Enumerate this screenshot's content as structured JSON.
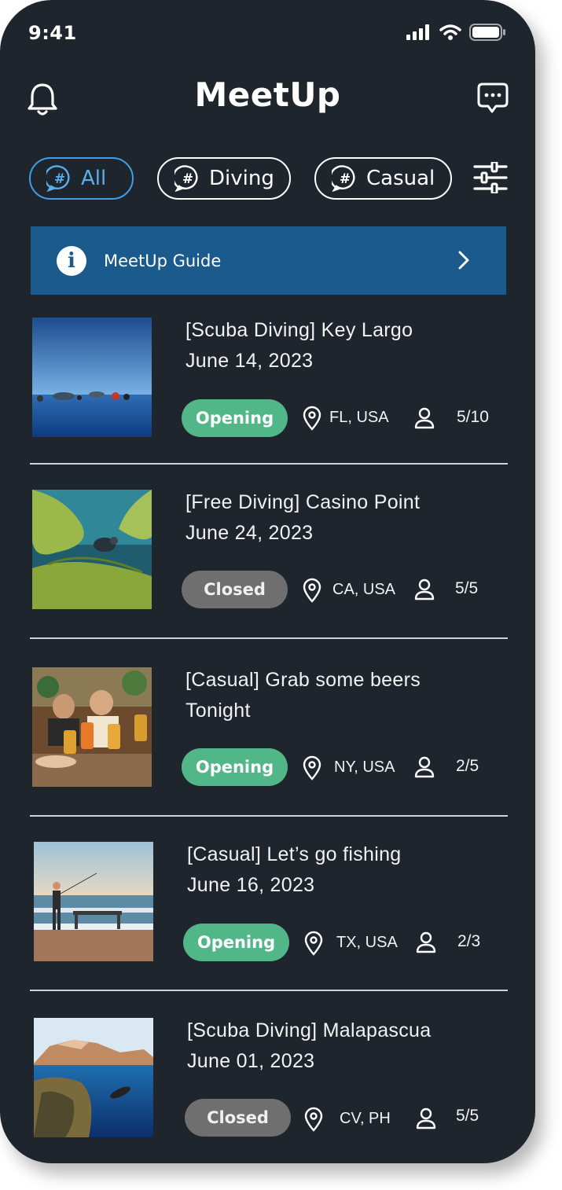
{
  "status_bar": {
    "time": "9:41"
  },
  "header": {
    "title": "MeetUp",
    "left_icon": "bell-icon",
    "right_icon": "chat-icon"
  },
  "filters": {
    "chips": [
      {
        "label": "All",
        "active": true
      },
      {
        "label": "Diving",
        "active": false
      },
      {
        "label": "Casual",
        "active": false
      }
    ],
    "settings_icon": "sliders-icon"
  },
  "guide": {
    "label": "MeetUp Guide",
    "icon": "info-icon"
  },
  "colors": {
    "background": "#1f252d",
    "accent": "#3e9ee6",
    "banner": "#1a5a8c",
    "opening": "#52b788",
    "closed": "#6f6f6f"
  },
  "meetups": [
    {
      "title_line1": "[Scuba Diving] Key Largo",
      "title_line2": "June 14, 2023",
      "status": "Opening",
      "location": "FL, USA",
      "attendees": "5/10",
      "image": "ocean-divers-photo"
    },
    {
      "title_line1": "[Free Diving] Casino Point",
      "title_line2": "June 24, 2023",
      "status": "Closed",
      "location": "CA, USA",
      "attendees": "5/5",
      "image": "kelp-diver-photo"
    },
    {
      "title_line1": "[Casual] Grab some beers",
      "title_line2": "Tonight",
      "status": "Opening",
      "location": "NY, USA",
      "attendees": "2/5",
      "image": "beer-toast-photo"
    },
    {
      "title_line1": "[Casual] Let’s go fishing",
      "title_line2": "June 16, 2023",
      "status": "Opening",
      "location": "TX, USA",
      "attendees": "2/3",
      "image": "pier-fishing-photo"
    },
    {
      "title_line1": "[Scuba Diving] Malapascua",
      "title_line2": "June 01, 2023",
      "status": "Closed",
      "location": "CV, PH",
      "attendees": "5/5",
      "image": "reef-split-photo"
    }
  ]
}
